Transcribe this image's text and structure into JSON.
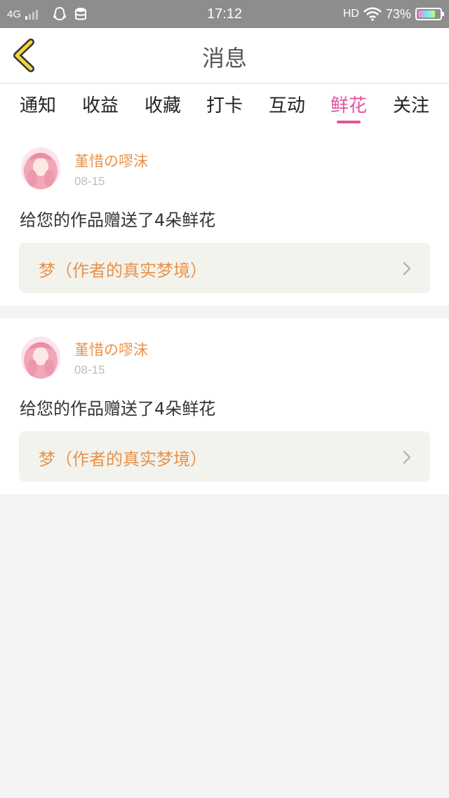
{
  "status_bar": {
    "network": "4G",
    "time": "17:12",
    "hd": "HD",
    "battery": "73%"
  },
  "header": {
    "title": "消息",
    "back_icon": "chevron-left-icon"
  },
  "tabs": [
    {
      "label": "通知",
      "active": false
    },
    {
      "label": "收益",
      "active": false
    },
    {
      "label": "收藏",
      "active": false
    },
    {
      "label": "打卡",
      "active": false
    },
    {
      "label": "互动",
      "active": false
    },
    {
      "label": "鲜花",
      "active": true
    },
    {
      "label": "关注",
      "active": false
    }
  ],
  "messages": [
    {
      "username": "堇惜の嘐沫",
      "date": "08-15",
      "text": "给您的作品赠送了4朵鲜花",
      "work_title": "梦（作者的真实梦境）"
    },
    {
      "username": "堇惜の嘐沫",
      "date": "08-15",
      "text": "给您的作品赠送了4朵鲜花",
      "work_title": "梦（作者的真实梦境）"
    }
  ],
  "colors": {
    "accent": "#e0559d",
    "name": "#e8924a",
    "statusbar": "#8d8d8d",
    "back_icon": "#f2d53a"
  }
}
